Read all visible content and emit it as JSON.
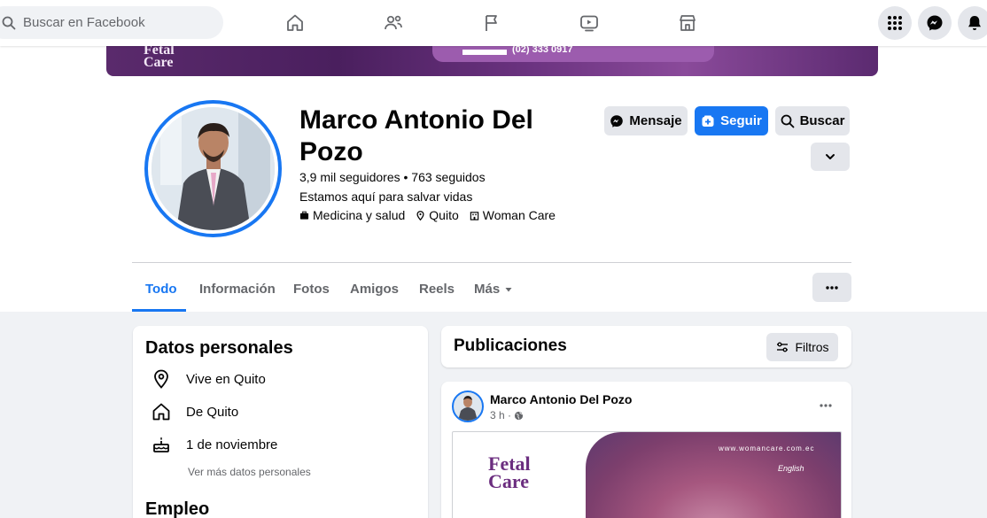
{
  "search": {
    "placeholder": "Buscar en Facebook"
  },
  "nav": {
    "icons": [
      "home-icon",
      "friends-icon",
      "pages-flag-icon",
      "watch-icon",
      "marketplace-icon"
    ],
    "right_icons": [
      "menu-grid-icon",
      "messenger-icon",
      "notifications-icon"
    ]
  },
  "cover": {
    "logo_line1": "Fetal",
    "logo_line2": "Care",
    "phone": "(02) 333 0917"
  },
  "profile": {
    "name": "Marco Antonio Del Pozo",
    "stats": "3,9 mil seguidores • 763 seguidos",
    "bio": "Estamos aquí para salvar vidas",
    "category": "Medicina y salud",
    "location": "Quito",
    "workplace": "Woman Care"
  },
  "actions": {
    "message": "Mensaje",
    "follow": "Seguir",
    "search": "Buscar"
  },
  "tabs": [
    {
      "label": "Todo",
      "active": true
    },
    {
      "label": "Información"
    },
    {
      "label": "Fotos"
    },
    {
      "label": "Amigos"
    },
    {
      "label": "Reels"
    },
    {
      "label": "Más"
    }
  ],
  "personal": {
    "title": "Datos personales",
    "items": [
      "Vive en Quito",
      "De Quito",
      "1 de noviembre"
    ],
    "more_link": "Ver más datos personales",
    "next_section": "Empleo"
  },
  "posts": {
    "title": "Publicaciones",
    "filter_label": "Filtros",
    "post": {
      "author": "Marco Antonio Del Pozo",
      "time": "3 h ·",
      "image": {
        "brand_line1": "Fetal",
        "brand_line2": "Care",
        "url": "www.womancare.com.ec",
        "lang": "English"
      }
    }
  },
  "colors": {
    "accent": "#1877f2",
    "background": "#f0f2f5",
    "button_grey": "#e4e6eb",
    "cover_purple": "#5a2a6c"
  }
}
